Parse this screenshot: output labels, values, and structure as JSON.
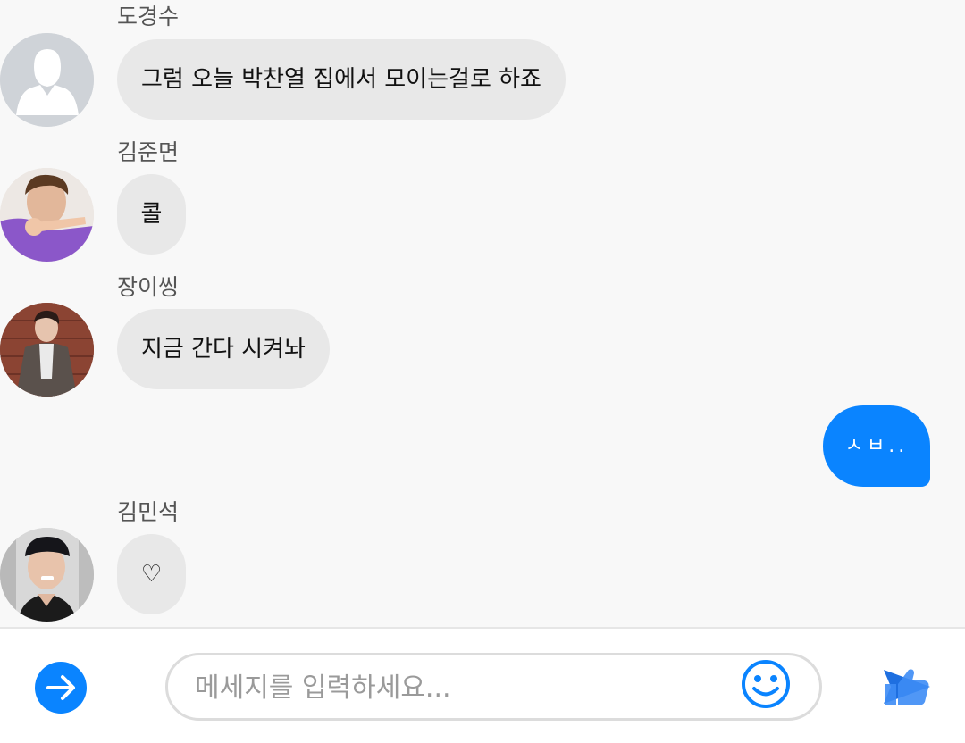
{
  "messages": [
    {
      "sender": "도경수",
      "text": "그럼 오늘 박찬열 집에서 모이는걸로 하죠",
      "avatar": "default-avatar"
    },
    {
      "sender": "김준면",
      "text": "콜",
      "avatar": "user-photo"
    },
    {
      "sender": "장이씽",
      "text": "지금 간다 시켜놔",
      "avatar": "user-photo"
    },
    {
      "sender": "김민석",
      "text": "♡",
      "avatar": "user-photo"
    }
  ],
  "my_message": {
    "text": "ㅅㅂ.."
  },
  "composer": {
    "placeholder": "메세지를 입력하세요...",
    "left_icon": "arrow-right-icon",
    "emoji_icon": "smiley-icon",
    "send_icon": "send-thumb-icon"
  },
  "colors": {
    "accent": "#0a84ff",
    "bubble_other": "#e8e8e8",
    "background": "#f8f8f8"
  }
}
